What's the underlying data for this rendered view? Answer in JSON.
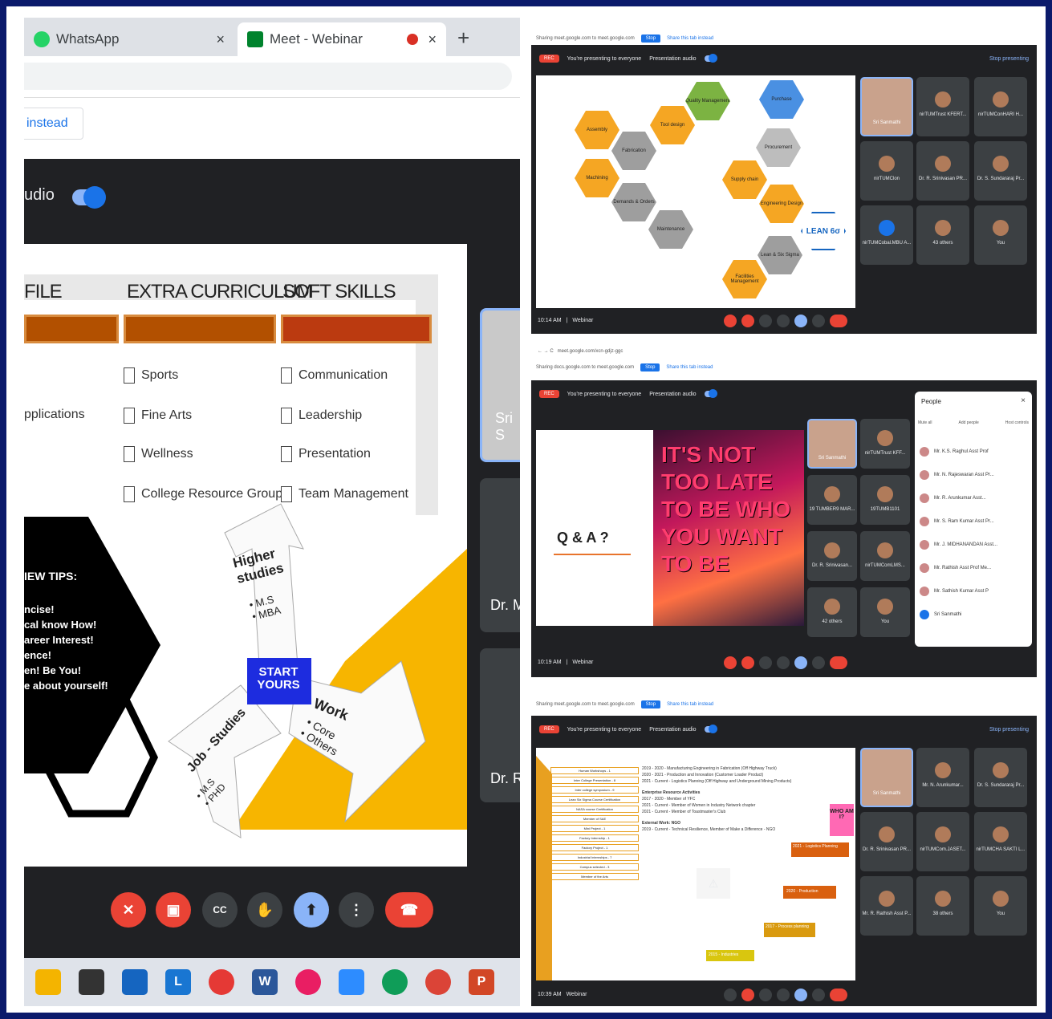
{
  "left": {
    "tabs": [
      {
        "label": "WhatsApp",
        "close": "×"
      },
      {
        "label": "Meet - Webinar",
        "close": "×"
      }
    ],
    "new_tab": "+",
    "banner_button": "instead",
    "audio_label": "udio",
    "slide": {
      "headers": [
        "FILE",
        "EXTRA CURRICULUM",
        "SOFT SKILLS"
      ],
      "col1_items": [
        "pplications"
      ],
      "extra_curriculum": [
        "Sports",
        "Fine Arts",
        "Wellness",
        "College Resource Groups"
      ],
      "soft_skills": [
        "Communication",
        "Leadership",
        "Presentation",
        "Team Management"
      ],
      "tips_title": "IEW TIPS:",
      "tips": [
        "ncise!",
        "cal know How!",
        "areer Interest!",
        "ence!",
        "en! Be You!",
        "e about yourself!"
      ],
      "higher_studies": "Higher studies",
      "higher_items": [
        "M.S",
        "MBA"
      ],
      "start": "START YOURS",
      "work": "Work",
      "work_items": [
        "Core",
        "Others"
      ],
      "job": "Job - Studies",
      "job_items": [
        "M.S",
        "PHD"
      ]
    },
    "side_tiles": [
      "Sri S",
      "Dr. M",
      "Dr. R"
    ],
    "taskbar_icons": [
      "folder-icon",
      "store-icon",
      "mail-icon",
      "l-app-icon",
      "chrome-icon",
      "word-icon",
      "snip-icon",
      "zoom-icon",
      "edge-icon",
      "chrome-profile-icon",
      "powerpoint-icon"
    ]
  },
  "panels": [
    {
      "bar": {
        "share_text": "Sharing meet.google.com to meet.google.com",
        "stop": "Stop",
        "hide": "Share this tab instead"
      },
      "top": {
        "rec": "REC",
        "presenting": "You're presenting to everyone",
        "audio": "Presentation audio",
        "stop": "Stop presenting"
      },
      "hexes": [
        "Assembly",
        "Tool design",
        "Quality Management",
        "Purchase",
        "Fabrication",
        "Procurement",
        "Machining",
        "Demands & Orders",
        "Supply chain",
        "Engineering Design",
        "Maintenance",
        "Lean & Six Sigma",
        "Facilities Management",
        "LEAN 6σ"
      ],
      "tiles": [
        "Sri Sanmathi",
        "nirTUMTrust KFERT...",
        "nirTUMConHARI H...",
        "nirTUMClon",
        "Dr. R. Srinivasan PR...",
        "Dr. S. Sundararaj Pr...",
        "nirTUMCobal.MBU A...",
        "43 others",
        "You"
      ],
      "time": "10:14 AM",
      "meeting": "Webinar"
    },
    {
      "browser": "meet.google.com/xcn-gdjz-ggc",
      "bar": {
        "share_text": "Sharing docs.google.com to meet.google.com",
        "stop": "Stop",
        "hide": "Share this tab instead"
      },
      "top": {
        "rec": "REC",
        "presenting": "You're presenting to everyone",
        "audio": "Presentation audio"
      },
      "qa": "Q & A ?",
      "quote": "IT'S NOT TOO LATE TO BE WHO YOU WANT TO BE",
      "tiles": [
        "Sri Sanmathi",
        "nirTUMTrust KFF...",
        "19 TUMBER9 MAR...",
        "19TUMB1101",
        "Dr. R. Srinivasan...",
        "nirTUMComLMS...",
        "42 others",
        "You"
      ],
      "people": {
        "title": "People",
        "actions": [
          "Mute all",
          "Add people",
          "Host controls"
        ],
        "list": [
          "Mr. K.S. Raghul Asst Prof",
          "Mr. N. Rajeswaran Asst Pr...",
          "Mr. R. Arunkumar Asst...",
          "Mr. S. Ram Kumar Asst Pr...",
          "Mr. J. MIDHANANDAN Asst...",
          "Mr. Rathish Asst Prof Me...",
          "Mr. Sathish Kumar Asst P",
          "Sri Sanmathi"
        ]
      },
      "time": "10:19 AM",
      "meeting": "Webinar"
    },
    {
      "bar": {
        "share_text": "Sharing meet.google.com to meet.google.com",
        "stop": "Stop",
        "hide": "Share this tab instead"
      },
      "top": {
        "rec": "REC",
        "presenting": "You're presenting to everyone",
        "audio": "Presentation audio",
        "stop": "Stop presenting"
      },
      "ladder": [
        "Human Workshops - 1",
        "Inter College Presentation - 8",
        "Inter college symposium - 9",
        "Lean Six Sigma Course Certification",
        "NASA course Certification",
        "Member of SAE",
        "Mini Project - 1",
        "Factory Internship - 1",
        "Factory Project - 1",
        "Industrial Internships - 7",
        "Campus selected - 3",
        "Member of the Arts"
      ],
      "milestones": [
        "2021 - Logistics Planning",
        "2020 - Production",
        "2017 - Process planning",
        "2015 - Industries"
      ],
      "text_lines": [
        "2019 - 2020 - Manufacturing Engineering in Fabrication (Off Highway Truck)",
        "2020 - 2021 - Production and Innovation (Customer Loader Product)",
        "2021 - Current - Logistics Planning (Off Highway and Underground Mining Products)",
        "Enterprise Resource Activities",
        "2017 - 2020 - Member of YFC",
        "2021 - Current - Member of Women in Industry Network chapter",
        "2021 - Current - Member of Toastmaster's Club",
        "External Work: NGO",
        "2019 - Current - Technical Resilience, Member of Make a Difference - NGO"
      ],
      "who": "WHO AM I?",
      "tiles": [
        "Sri Sanmathi",
        "Mr. N. Arunkumar...",
        "Dr. S. Sundararaj Pr...",
        "Dr. R. Srinivasan PR...",
        "nirTUMCom.JASET...",
        "nirTUMCHA SAKTI L...",
        "Mr. R. Rathish Asst P...",
        "38 others",
        "You"
      ],
      "time": "10:39 AM",
      "meeting": "Webinar"
    }
  ]
}
